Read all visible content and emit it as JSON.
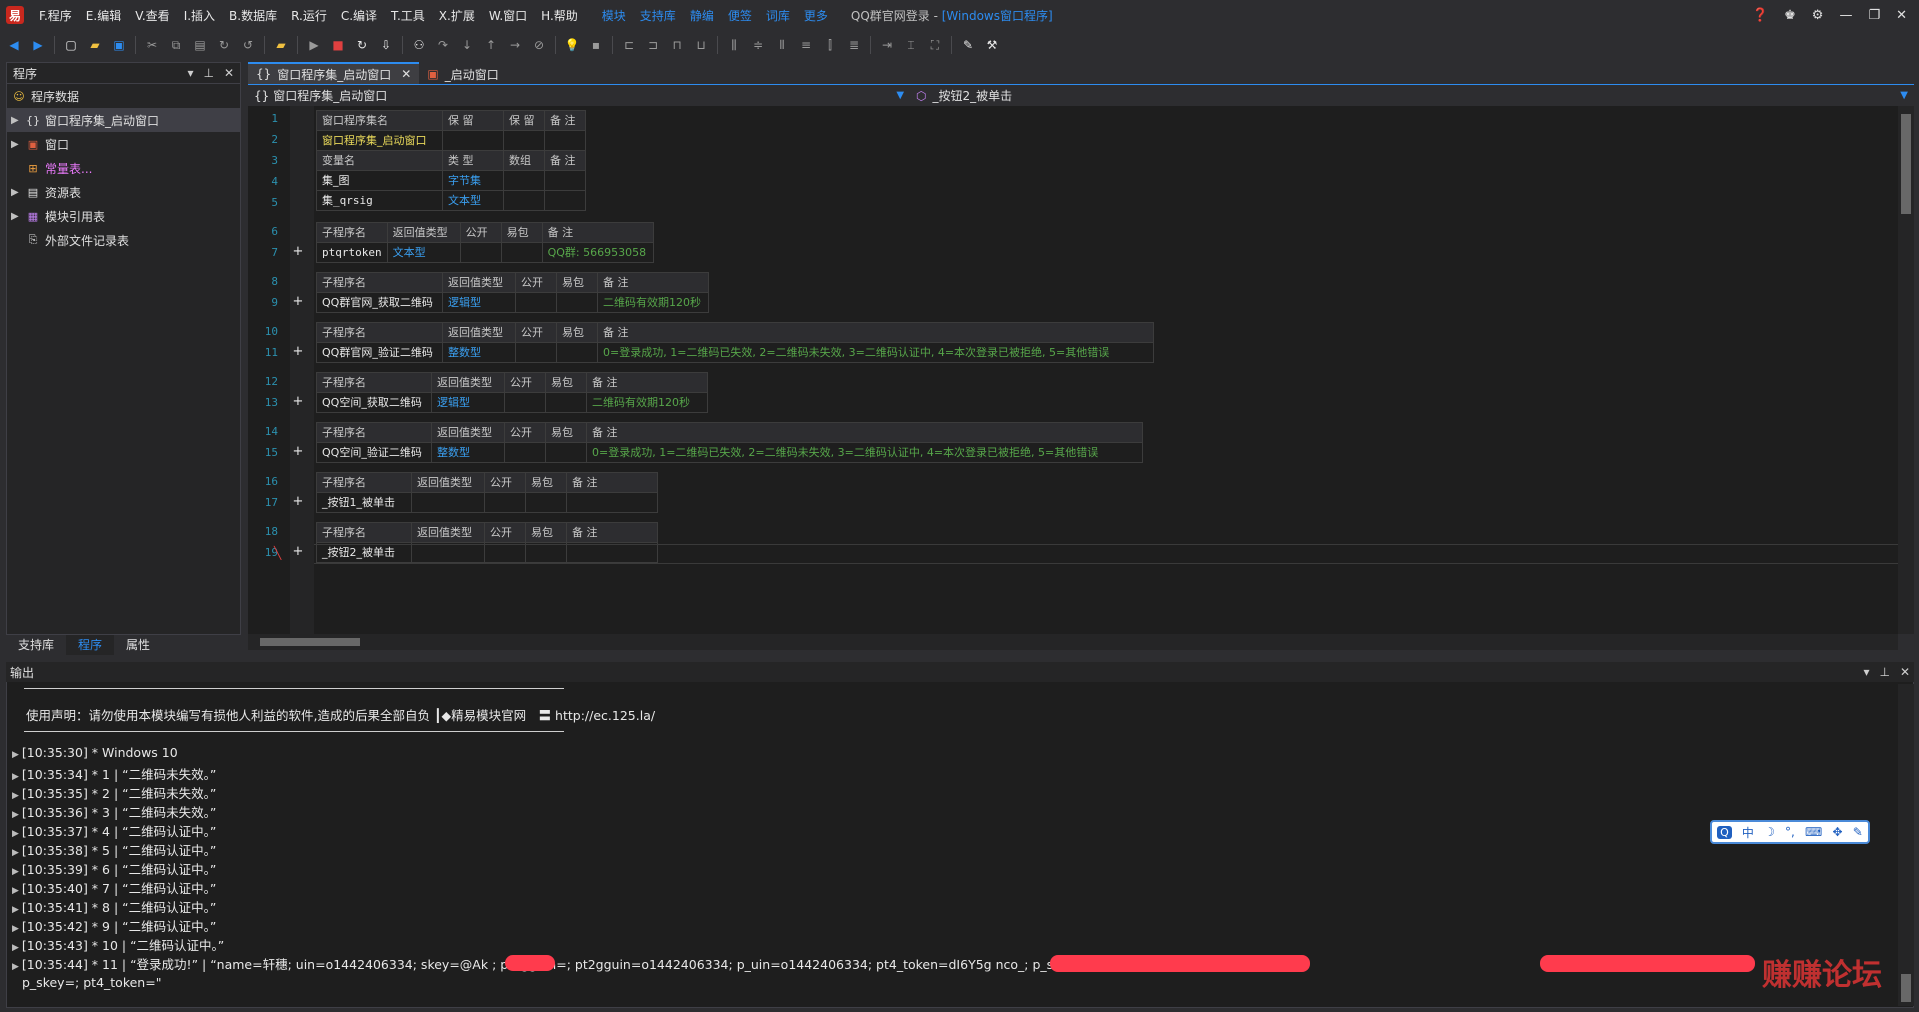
{
  "menubar": {
    "items": [
      "F.程序",
      "E.编辑",
      "V.查看",
      "I.插入",
      "B.数据库",
      "R.运行",
      "C.编译",
      "T.工具",
      "X.扩展",
      "W.窗口",
      "H.帮助"
    ],
    "links": [
      "模块",
      "支持库",
      "静编",
      "便签",
      "词库",
      "更多"
    ],
    "title_prefix": "QQ群官网登录 - ",
    "title_suffix": "[Windows窗口程序]"
  },
  "left_panel": {
    "title": "程序",
    "items": [
      {
        "label": "程序数据"
      },
      {
        "label": "窗口程序集_启动窗口"
      },
      {
        "label": "窗口"
      },
      {
        "label": "常量表..."
      },
      {
        "label": "资源表"
      },
      {
        "label": "模块引用表"
      },
      {
        "label": "外部文件记录表"
      }
    ],
    "tabs": [
      "支持库",
      "程序",
      "属性"
    ]
  },
  "editor": {
    "tabs": [
      "窗口程序集_启动窗口",
      "_启动窗口"
    ],
    "nav_left": "窗口程序集_启动窗口",
    "nav_right": "_按钮2_被单击",
    "line_numbers": [
      "1",
      "2",
      "3",
      "4",
      "5",
      "6",
      "7",
      "8",
      "9",
      "10",
      "11",
      "12",
      "13",
      "14",
      "15",
      "16",
      "17",
      "18",
      "19"
    ],
    "headers": {
      "assembly": [
        "窗口程序集名",
        "保 留",
        "保 留",
        "备 注"
      ],
      "vars": [
        "变量名",
        "类 型",
        "数组",
        "备 注"
      ],
      "sub": [
        "子程序名",
        "返回值类型",
        "公开",
        "易包",
        "备 注"
      ]
    },
    "assembly_name": "窗口程序集_启动窗口",
    "vars": [
      {
        "name": "集_图",
        "type": "字节集"
      },
      {
        "name": "集_qrsig",
        "type": "文本型"
      }
    ],
    "subs": [
      {
        "name": "ptqrtoken",
        "type": "文本型",
        "note": "QQ群: 566953058"
      },
      {
        "name": "QQ群官网_获取二维码",
        "type": "逻辑型",
        "note": "二维码有效期120秒"
      },
      {
        "name": "QQ群官网_验证二维码",
        "type": "整数型",
        "note": "0=登录成功, 1=二维码已失效, 2=二维码未失效, 3=二维码认证中, 4=本次登录已被拒绝, 5=其他错误"
      },
      {
        "name": "QQ空间_获取二维码",
        "type": "逻辑型",
        "note": "二维码有效期120秒"
      },
      {
        "name": "QQ空间_验证二维码",
        "type": "整数型",
        "note": "0=登录成功, 1=二维码已失效, 2=二维码未失效, 3=二维码认证中, 4=本次登录已被拒绝, 5=其他错误"
      },
      {
        "name": "_按钮1_被单击",
        "type": "",
        "note": ""
      },
      {
        "name": "_按钮2_被单击",
        "type": "",
        "note": ""
      }
    ]
  },
  "output": {
    "title": "输出",
    "disclaimer": "使用声明：请勿使用本模块编写有损他人利益的软件,造成的后果全部自负 ┃◆精易模块官网　〓 http://ec.125.la/",
    "logs": [
      "[10:35:30] * Windows 10",
      "[10:35:34] * 1 | “二维码未失效。”",
      "[10:35:35] * 2 | “二维码未失效。”",
      "[10:35:36] * 3 | “二维码未失效。”",
      "[10:35:37] * 4 | “二维码认证中。”",
      "[10:35:38] * 5 | “二维码认证中。”",
      "[10:35:39] * 6 | “二维码认证中。”",
      "[10:35:40] * 7 | “二维码认证中。”",
      "[10:35:41] * 8 | “二维码认证中。”",
      "[10:35:42] * 9 | “二维码认证中。”",
      "[10:35:43] * 10 | “二维码认证中。”",
      "[10:35:44] * 11 | “登录成功!” | “name=轩穗; uin=o1442406334; skey=@Ak          ; pt2gguin=; pt2gguin=o1442406334; p_uin=o1442406334; pt4_token=dI6Y5g                                                    nco_; p_skey_forbid=; p_skey=e0uciv"
    ],
    "log_cont": "p_skey=; pt4_token=\"",
    "ime": [
      "中",
      "☽",
      "°,",
      "⌨",
      "✥",
      "✎"
    ]
  },
  "watermark": "赚赚论坛",
  "colors": {
    "accent": "#2d8cf0",
    "keyword": "#3a9ff0",
    "comment": "#57a64a",
    "assembly": "#e8d85a",
    "redaction": "#ff3b4d"
  }
}
